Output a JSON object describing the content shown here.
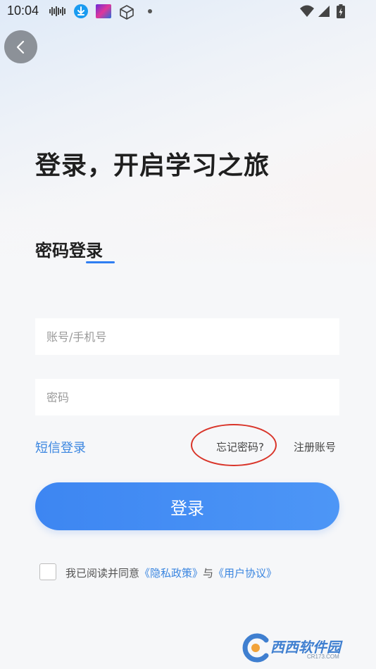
{
  "status_bar": {
    "time": "10:04"
  },
  "login": {
    "headline": "登录，开启学习之旅",
    "tab_title": "密码登录",
    "account_placeholder": "账号/手机号",
    "password_placeholder": "密码",
    "sms_login": "短信登录",
    "forgot_password": "忘记密码?",
    "register": "注册账号",
    "submit_label": "登录"
  },
  "agreement": {
    "prefix": "我已阅读并同意",
    "privacy_policy": "《隐私政策》",
    "conjunction": "与",
    "user_agreement": "《用户协议》",
    "checked": false
  },
  "watermark": {
    "text": "西西软件园",
    "url_text": "CR173.COM"
  },
  "colors": {
    "accent": "#3d86f2",
    "link": "#3b86e0",
    "annotation": "#d9352a"
  }
}
